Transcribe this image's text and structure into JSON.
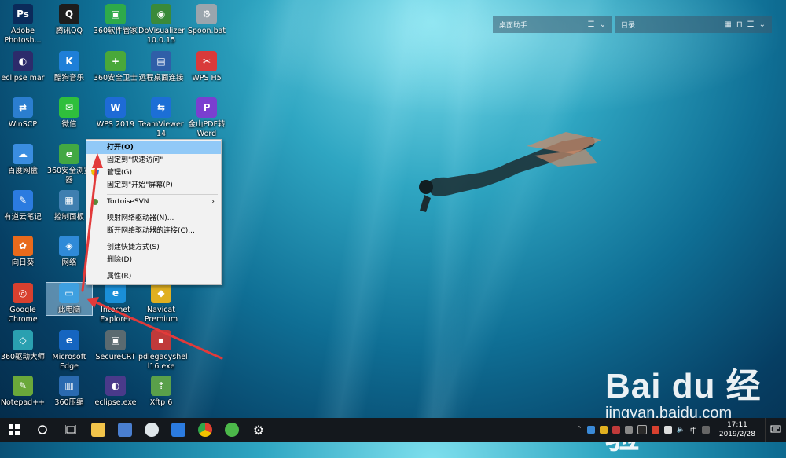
{
  "desktop_icons": [
    {
      "label": "Adobe Photosh...",
      "glyph": "Ps",
      "color": "#0b2a5a"
    },
    {
      "label": "腾讯QQ",
      "glyph": "Q",
      "color": "#1d1d1d"
    },
    {
      "label": "360软件管家",
      "glyph": "▣",
      "color": "#2eaa4a"
    },
    {
      "label": "DbVisualizer 10.0.15",
      "glyph": "◉",
      "color": "#3a8a3a"
    },
    {
      "label": "Spoon.bat",
      "glyph": "⚙",
      "color": "#9aa5ad"
    },
    {
      "label": "eclipse mar",
      "glyph": "◐",
      "color": "#2c2b6b"
    },
    {
      "label": "酷狗音乐",
      "glyph": "K",
      "color": "#1e7fd8"
    },
    {
      "label": "360安全卫士",
      "glyph": "+",
      "color": "#49a83a"
    },
    {
      "label": "远程桌面连接",
      "glyph": "▤",
      "color": "#2f5fa8"
    },
    {
      "label": "WPS H5",
      "glyph": "✂",
      "color": "#d93a3a"
    },
    {
      "label": "WinSCP",
      "glyph": "⇄",
      "color": "#2b7ed0"
    },
    {
      "label": "微信",
      "glyph": "✉",
      "color": "#2fbf3c"
    },
    {
      "label": "WPS 2019",
      "glyph": "W",
      "color": "#1e6bd6"
    },
    {
      "label": "TeamViewer 14",
      "glyph": "⇆",
      "color": "#1c6fd6"
    },
    {
      "label": "金山PDF转 Word",
      "glyph": "P",
      "color": "#7a3fd0"
    },
    {
      "label": "百度网盘",
      "glyph": "☁",
      "color": "#3a8de0"
    },
    {
      "label": "360安全浏览器",
      "glyph": "e",
      "color": "#42a843"
    },
    {
      "label": "有道云笔记",
      "glyph": "✎",
      "color": "#2b7be0"
    },
    {
      "label": "控制面板",
      "glyph": "▦",
      "color": "#3f7fb0"
    },
    {
      "label": "向日葵",
      "glyph": "✿",
      "color": "#e86a1c"
    },
    {
      "label": "网络",
      "glyph": "◈",
      "color": "#2f8ad8"
    },
    {
      "label": "Google Chrome",
      "glyph": "◎",
      "color": "#d8402f"
    },
    {
      "label": "此电脑",
      "glyph": "▭",
      "color": "#3fa0e0"
    },
    {
      "label": "Internet Explorer",
      "glyph": "e",
      "color": "#1a8fd8"
    },
    {
      "label": "Navicat Premium",
      "glyph": "◆",
      "color": "#e0b020"
    },
    {
      "label": "360驱动大师",
      "glyph": "◇",
      "color": "#2aa0b0"
    },
    {
      "label": "Microsoft Edge",
      "glyph": "e",
      "color": "#1565c0"
    },
    {
      "label": "SecureCRT",
      "glyph": "▣",
      "color": "#5a6a70"
    },
    {
      "label": "pdlegacyshel l16.exe",
      "glyph": "▪",
      "color": "#c03a3a"
    },
    {
      "label": "Notepad++",
      "glyph": "✎",
      "color": "#6aa83a"
    },
    {
      "label": "360压缩",
      "glyph": "▥",
      "color": "#2a6ab0"
    },
    {
      "label": "eclipse.exe",
      "glyph": "◐",
      "color": "#4a3a8a"
    },
    {
      "label": "Xftp 6",
      "glyph": "⇡",
      "color": "#5aa04a"
    }
  ],
  "widgets": {
    "left_title": "桌面助手",
    "right_title": "目录"
  },
  "context_menu": {
    "items": [
      {
        "label": "打开(O)",
        "highlighted": true
      },
      {
        "label": "固定到\"快速访问\""
      },
      {
        "label": "管理(G)",
        "icon": "shield-icon"
      },
      {
        "label": "固定到\"开始\"屏幕(P)"
      },
      {
        "label": "TortoiseSVN",
        "submenu": true,
        "icon": "tortoise-icon"
      },
      {
        "label": "映射网络驱动器(N)..."
      },
      {
        "label": "断开网络驱动器的连接(C)..."
      },
      {
        "label": "创建快捷方式(S)"
      },
      {
        "label": "删除(D)"
      },
      {
        "label": "属性(R)"
      }
    ]
  },
  "watermark": {
    "logo": "Bai du 经验",
    "url": "jingyan.baidu.com"
  },
  "taskbar": {
    "clock_time": "17:11",
    "clock_date": "2019/2/28",
    "ime": "中"
  },
  "colors": {
    "accent": "#91c9f7",
    "taskbar": "#14181d",
    "annotation": "#e23a3a"
  }
}
